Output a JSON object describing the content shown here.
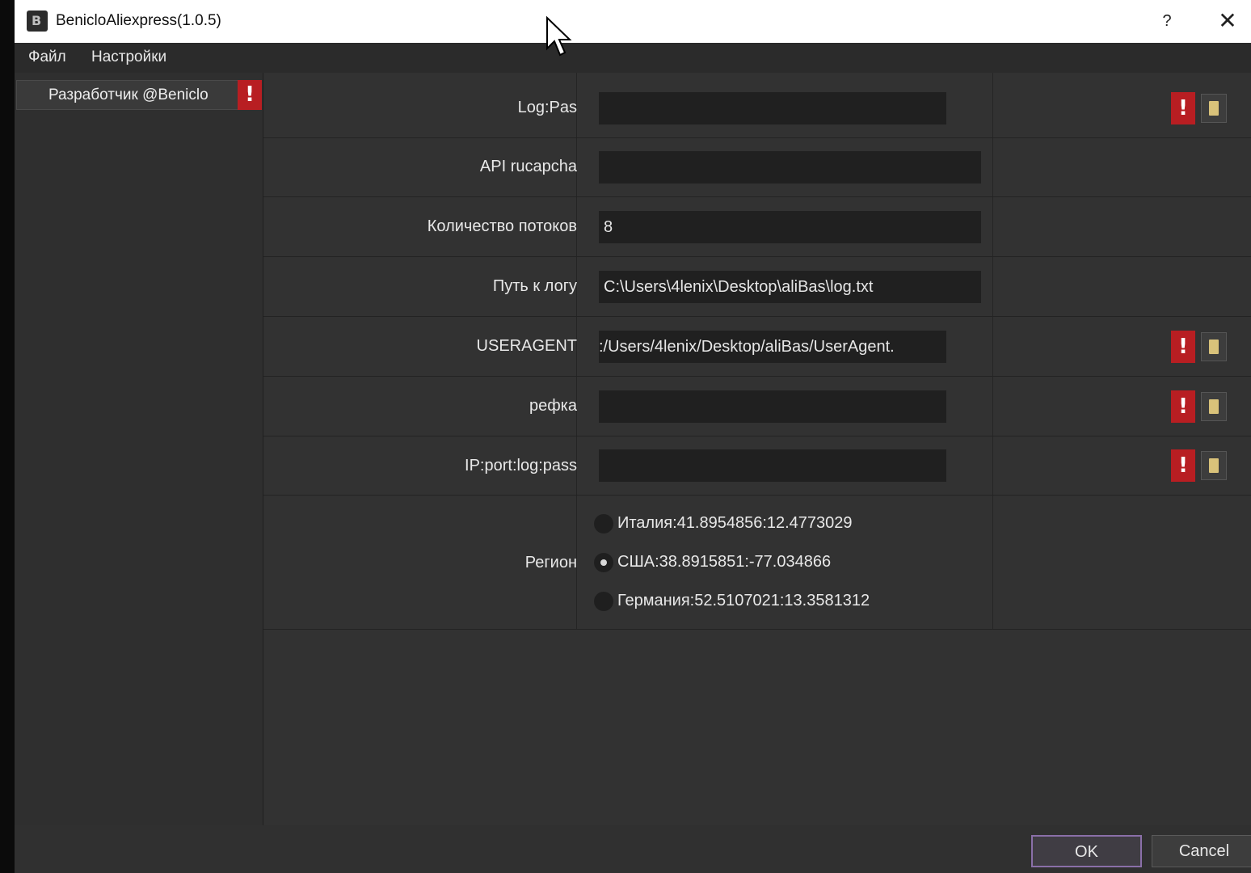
{
  "window": {
    "title": "BenicloAliexpress(1.0.5)",
    "help_label": "?",
    "close_label": "✕"
  },
  "menu": {
    "items": [
      "Файл",
      "Настройки"
    ]
  },
  "sidebar": {
    "items": [
      {
        "label": "Разработчик @Beniclo",
        "warning": "!"
      }
    ]
  },
  "form": {
    "rows": [
      {
        "label": "Log:Pas",
        "value": "",
        "warning": "!",
        "has_browse": true
      },
      {
        "label": "API rucapcha",
        "value": ""
      },
      {
        "label": "Количество потоков",
        "value": "8"
      },
      {
        "label": "Путь к логу",
        "value": "C:\\Users\\4lenix\\Desktop\\aliBas\\log.txt"
      },
      {
        "label": "USERAGENT",
        "value": ":/Users/4lenix/Desktop/aliBas/UserAgent.",
        "warning": "!",
        "has_browse": true
      },
      {
        "label": "рефка",
        "value": "",
        "warning": "!",
        "has_browse": true
      },
      {
        "label": "IP:port:log:pass",
        "value": "",
        "warning": "!",
        "has_browse": true
      }
    ],
    "region": {
      "label": "Регион",
      "options": [
        {
          "label": "Италия:41.8954856:12.4773029",
          "checked": false
        },
        {
          "label": "США:38.8915851:-77.034866",
          "checked": true
        },
        {
          "label": "Германия:52.5107021:13.3581312",
          "checked": false
        }
      ]
    }
  },
  "footer": {
    "ok_label": "OK",
    "cancel_label": "Cancel"
  },
  "colors": {
    "warning": "#b81e22",
    "accent": "#8a6fa8"
  }
}
